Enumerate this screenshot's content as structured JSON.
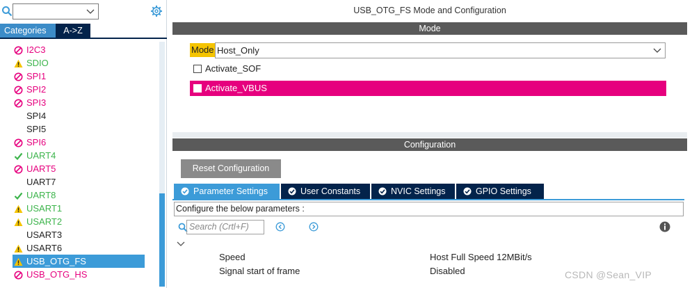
{
  "left_panel": {
    "search": {
      "value": ""
    },
    "tabs": {
      "categories": "Categories",
      "az": "A->Z"
    },
    "items": [
      {
        "label": "I2C3",
        "status": "disabled",
        "color": "pink"
      },
      {
        "label": "SDIO",
        "status": "warning",
        "color": "green"
      },
      {
        "label": "SPI1",
        "status": "disabled",
        "color": "pink"
      },
      {
        "label": "SPI2",
        "status": "disabled",
        "color": "pink"
      },
      {
        "label": "SPI3",
        "status": "disabled",
        "color": "pink"
      },
      {
        "label": "SPI4",
        "status": "none",
        "color": "black"
      },
      {
        "label": "SPI5",
        "status": "none",
        "color": "black"
      },
      {
        "label": "SPI6",
        "status": "disabled",
        "color": "pink"
      },
      {
        "label": "UART4",
        "status": "ok",
        "color": "green"
      },
      {
        "label": "UART5",
        "status": "disabled",
        "color": "pink"
      },
      {
        "label": "UART7",
        "status": "none",
        "color": "black"
      },
      {
        "label": "UART8",
        "status": "ok",
        "color": "green"
      },
      {
        "label": "USART1",
        "status": "warning",
        "color": "green"
      },
      {
        "label": "USART2",
        "status": "warning",
        "color": "green"
      },
      {
        "label": "USART3",
        "status": "none",
        "color": "black"
      },
      {
        "label": "USART6",
        "status": "warning",
        "color": "black"
      },
      {
        "label": "USB_OTG_FS",
        "status": "warning",
        "color": "selected"
      },
      {
        "label": "USB_OTG_HS",
        "status": "disabled",
        "color": "pink"
      }
    ]
  },
  "right_panel": {
    "title": "USB_OTG_FS Mode and Configuration",
    "mode_header": "Mode",
    "mode_label": "Mode",
    "mode_value": "Host_Only",
    "activate_sof": "Activate_SOF",
    "activate_vbus": "Activate_VBUS",
    "config_header": "Configuration",
    "reset_button": "Reset Configuration",
    "tabs": [
      {
        "label": "Parameter Settings",
        "active": true
      },
      {
        "label": "User Constants",
        "active": false
      },
      {
        "label": "NVIC Settings",
        "active": false
      },
      {
        "label": "GPIO Settings",
        "active": false
      }
    ],
    "configure_text": "Configure the below parameters :",
    "search_placeholder": "Search (Crtl+F)",
    "params": [
      {
        "name": "Speed",
        "value": "Host Full Speed 12MBit/s"
      },
      {
        "name": "Signal start of frame",
        "value": "Disabled"
      }
    ]
  },
  "watermark": "CSDN @Sean_VIP",
  "colors": {
    "accent_blue": "#3c9bd8",
    "dark_navy": "#03234b",
    "error_pink": "#e6007e",
    "ok_green": "#3cb44b",
    "warning_yellow": "#f5c400",
    "header_gray": "#5a5a5a"
  }
}
